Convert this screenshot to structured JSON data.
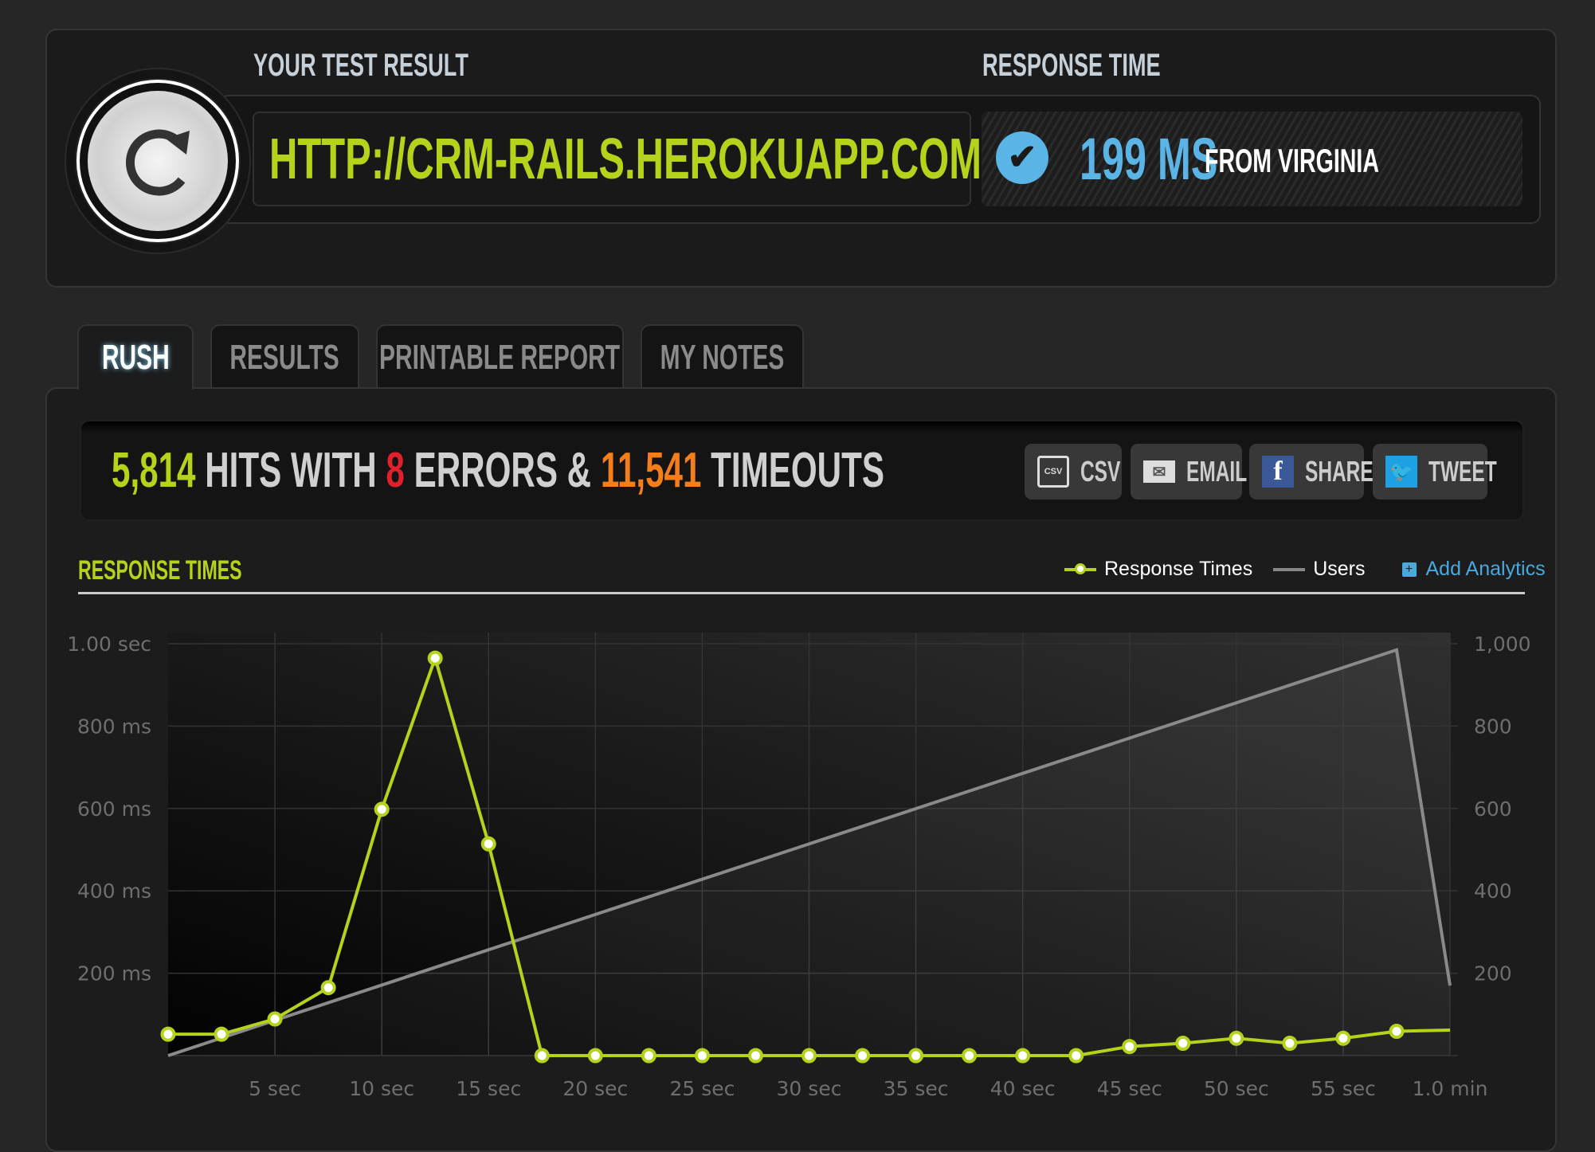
{
  "header": {
    "test_result_label": "YOUR TEST RESULT",
    "url": "HTTP://CRM-RAILS.HEROKUAPP.COM/",
    "response_time_label": "RESPONSE TIME",
    "response_time_value": "199 MS",
    "response_location": "FROM VIRGINIA",
    "icons": {
      "rerun": "refresh-icon",
      "status": "check-circle-icon"
    }
  },
  "tabs": [
    {
      "label": "RUSH",
      "active": true
    },
    {
      "label": "RESULTS"
    },
    {
      "label": "PRINTABLE REPORT"
    },
    {
      "label": "MY NOTES"
    }
  ],
  "stats": {
    "hits": "5,814",
    "hits_text": "HITS WITH",
    "errors": "8",
    "errors_text": "ERRORS &",
    "timeouts": "11,541",
    "timeouts_text": "TIMEOUTS"
  },
  "share_buttons": [
    {
      "label": "CSV",
      "icon": "csv-file-icon"
    },
    {
      "label": "EMAIL",
      "icon": "envelope-icon"
    },
    {
      "label": "SHARE",
      "icon": "facebook-icon"
    },
    {
      "label": "TWEET",
      "icon": "twitter-icon"
    }
  ],
  "chart_section": {
    "title": "RESPONSE TIMES",
    "legend_response": "Response Times",
    "legend_users": "Users",
    "add_analytics": "Add Analytics"
  },
  "colors": {
    "accent": "#b5d31a",
    "error": "#e0202a",
    "timeout": "#f47f1a",
    "blue": "#5ab4e6",
    "users_line": "#8a8a8a"
  },
  "chart_data": {
    "type": "line",
    "x_tick_labels": [
      "5 sec",
      "10 sec",
      "15 sec",
      "20 sec",
      "25 sec",
      "30 sec",
      "35 sec",
      "40 sec",
      "45 sec",
      "50 sec",
      "55 sec",
      "1.0 min"
    ],
    "x_ticks": [
      5,
      10,
      15,
      20,
      25,
      30,
      35,
      40,
      45,
      50,
      55,
      60
    ],
    "xlim": [
      0,
      60
    ],
    "y_left": {
      "range": [
        0,
        1000
      ],
      "ticks": [
        200,
        400,
        600,
        800,
        1000
      ],
      "tick_labels": [
        "200 ms",
        "400 ms",
        "600 ms",
        "800 ms",
        "1.00 sec"
      ]
    },
    "y_right": {
      "range": [
        0,
        1000
      ],
      "ticks": [
        200,
        400,
        600,
        800,
        1000
      ],
      "tick_labels": [
        "200",
        "400",
        "600",
        "800",
        "1,000"
      ]
    },
    "grid": true,
    "series": [
      {
        "name": "Response Times",
        "axis": "left",
        "unit": "ms",
        "color": "#b5d31a",
        "x": [
          0,
          2.5,
          5,
          7.5,
          10,
          12.5,
          15,
          17.5,
          20,
          22.5,
          25,
          27.5,
          30,
          32.5,
          35,
          37.5,
          40,
          42.5,
          45,
          47.5,
          50,
          52.5,
          55,
          57.5,
          60
        ],
        "y": [
          52,
          52,
          89,
          165,
          598,
          965,
          514,
          0,
          0,
          0,
          0,
          0,
          0,
          0,
          0,
          0,
          0,
          0,
          22,
          30,
          42,
          30,
          42,
          59,
          62
        ]
      },
      {
        "name": "Users",
        "axis": "right",
        "color": "#8a8a8a",
        "x": [
          0,
          57.5,
          60
        ],
        "y": [
          0,
          985,
          170
        ]
      }
    ]
  }
}
